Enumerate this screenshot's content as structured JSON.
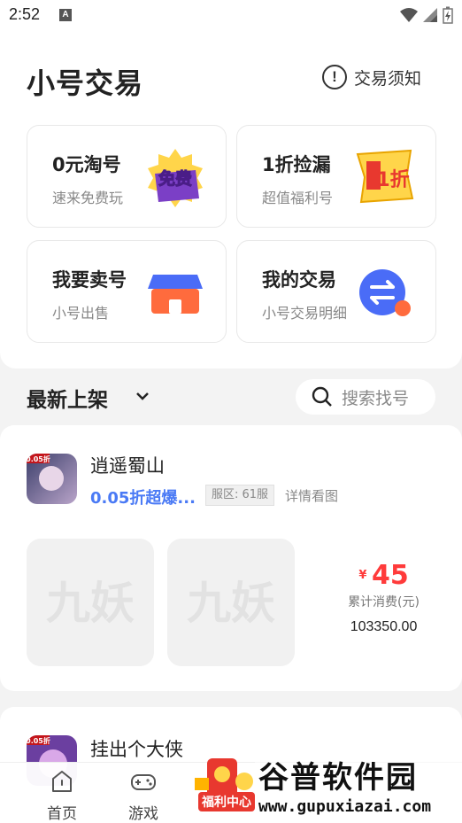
{
  "status_bar": {
    "time": "2:52",
    "notif_letter": "A"
  },
  "header": {
    "title": "小号交易",
    "notice_label": "交易须知",
    "notice_icon": "exclamation-circle-icon"
  },
  "cards": [
    {
      "title": "0元淘号",
      "subtitle": "速来免费玩",
      "badge": "免费",
      "icon": "free-badge-icon"
    },
    {
      "title": "1折捡漏",
      "subtitle": "超值福利号",
      "badge": "1折",
      "icon": "discount-flag-icon"
    },
    {
      "title": "我要卖号",
      "subtitle": "小号出售",
      "icon": "shop-icon"
    },
    {
      "title": "我的交易",
      "subtitle": "小号交易明细",
      "icon": "exchange-icon"
    }
  ],
  "section": {
    "title": "最新上架",
    "search_placeholder": "搜索找号"
  },
  "listings": [
    {
      "name": "逍遥蜀山",
      "tag": "0.05折超爆...",
      "server": "服区: 61服",
      "detail": "详情看图",
      "icon_badge": "0.05折",
      "shot_text": "九妖",
      "currency": "¥",
      "price": "45",
      "spent_label": "累计消费(元)",
      "spent_value": "103350.00"
    },
    {
      "name": "挂出个大侠",
      "icon_badge": "0.05折"
    }
  ],
  "bottom_nav": [
    {
      "label": "首页",
      "icon": "home-icon"
    },
    {
      "label": "游戏",
      "icon": "gamepad-icon"
    }
  ],
  "fuli": {
    "label": "福利中心"
  },
  "watermark": {
    "title": "谷普软件园",
    "url": "www.gupuxiazai.com"
  },
  "colors": {
    "accent_blue": "#4a7af5",
    "price_red": "#ff3b3b",
    "shop_orange": "#ff6b3d",
    "exchange_blue": "#4a6cf7"
  }
}
